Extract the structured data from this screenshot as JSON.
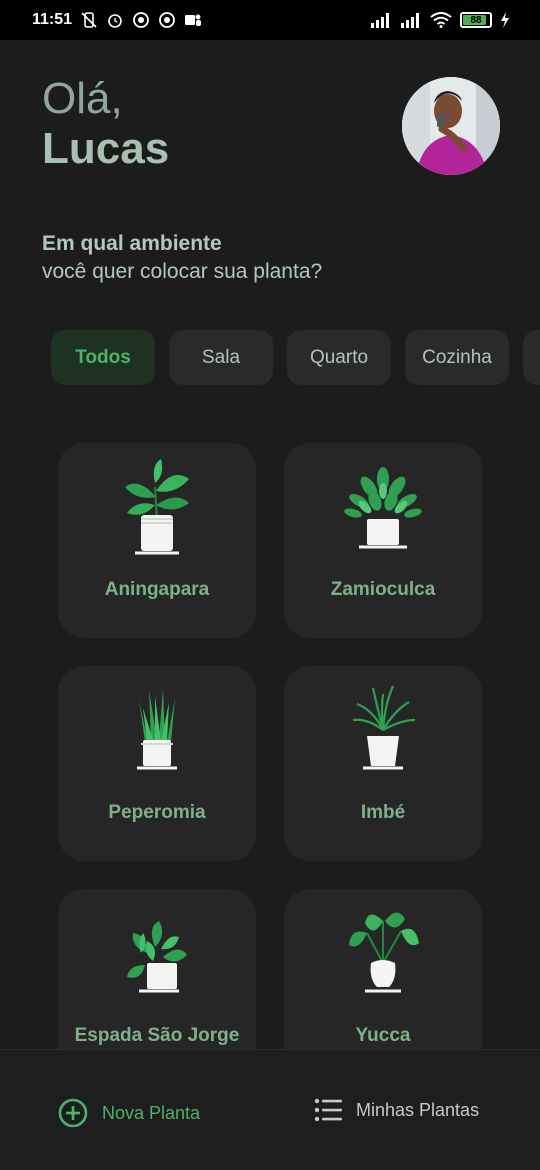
{
  "status_bar": {
    "time": "11:51",
    "battery": "88",
    "battery_level": 0.88,
    "icons": [
      "vibrate-off-icon",
      "alarm-icon",
      "vpn-icon",
      "vpn-icon",
      "teams-icon",
      "signal-icon",
      "signal-icon",
      "wifi-icon",
      "battery-icon",
      "charging-icon"
    ]
  },
  "header": {
    "greeting": "Olá,",
    "user_name": "Lucas"
  },
  "prompt": {
    "title": "Em qual ambiente",
    "subtitle": "você quer colocar sua planta?"
  },
  "environments": [
    {
      "label": "Todos",
      "active": true
    },
    {
      "label": "Sala",
      "active": false
    },
    {
      "label": "Quarto",
      "active": false
    },
    {
      "label": "Cozinha",
      "active": false
    },
    {
      "label": "",
      "active": false
    }
  ],
  "plants": [
    {
      "name": "Aningapara",
      "icon": "plant-broadleaf-icon"
    },
    {
      "name": "Zamioculca",
      "icon": "plant-bushy-icon"
    },
    {
      "name": "Peperomia",
      "icon": "plant-snake-icon"
    },
    {
      "name": "Imbé",
      "icon": "plant-palm-icon"
    },
    {
      "name": "Espada São Jorge",
      "icon": "plant-pothos-icon"
    },
    {
      "name": "Yucca",
      "icon": "plant-elephant-ear-icon"
    }
  ],
  "bottom_nav": {
    "new_plant": "Nova Planta",
    "my_plants": "Minhas Plantas"
  },
  "colors": {
    "background": "#1c1c1c",
    "card": "#262626",
    "accent_green": "#4cb36b",
    "text_muted": "#8fa79a"
  }
}
